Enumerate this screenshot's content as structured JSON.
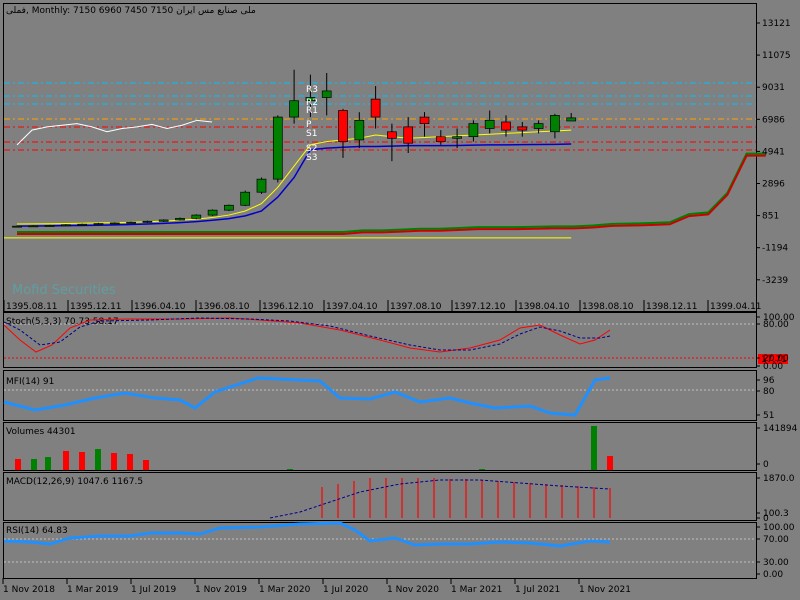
{
  "header": {
    "symbol": "فملی",
    "timeframe": "Monthly",
    "ohlc": "7150 6960 7450 7150",
    "company": "ملی صنایع مس ایران"
  },
  "watermark": "Mofid Securities",
  "colors": {
    "background": "#808080",
    "bull": "#008000",
    "bear": "#ff0000",
    "ma_fast": "#ffff00",
    "ma_slow": "#0000cc",
    "envelope_red": "#cc0000",
    "envelope_green": "#008000",
    "white_line": "#ffffff",
    "indicator_line": "#1e90ff",
    "level_cyan": "#00bfff",
    "level_red": "#ff0000",
    "level_orange": "#ffa500"
  },
  "main_axis": {
    "ticks": [
      "13121",
      "11075",
      "9031",
      "6986",
      "4941",
      "2896",
      "851",
      "-1194",
      "-3239"
    ]
  },
  "date_axis_top": [
    "1395.08.11",
    "1395.12.11",
    "1396.04.10",
    "1396.08.10",
    "1396.12.10",
    "1397.04.10",
    "1397.08.10",
    "1397.12.10",
    "1398.04.10",
    "1398.08.10",
    "1398.12.11",
    "1399.04.11"
  ],
  "date_axis_bottom": [
    "1 Nov 2018",
    "1 Mar 2019",
    "1 Jul 2019",
    "1 Nov 2019",
    "1 Mar 2020",
    "1 Jul 2020",
    "1 Nov 2020",
    "1 Mar 2021",
    "1 Jul 2021",
    "1 Nov 2021"
  ],
  "pivot_labels": [
    "R3",
    "R2",
    "R1",
    "P",
    "S1",
    "S2",
    "S3"
  ],
  "stoch": {
    "label": "Stoch(5,3,3) 70.73 58.17",
    "ticks": [
      "100.00",
      "80.00",
      "20.00",
      "0.00"
    ],
    "badge": "17.71"
  },
  "mfi": {
    "label": "MFI(14) 91",
    "ticks": [
      "96",
      "80",
      "51"
    ]
  },
  "volumes": {
    "label": "Volumes 44301",
    "ticks": [
      "141894",
      "0"
    ]
  },
  "macd": {
    "label": "MACD(12,26,9) 1047.6 1167.5",
    "ticks": [
      "1870.0",
      "100.3",
      "0"
    ]
  },
  "rsi": {
    "label": "RSI(14) 64.83",
    "ticks": [
      "100.00",
      "70.00",
      "30.00",
      "0.00"
    ]
  },
  "chart_data": {
    "type": "candlestick",
    "title": "فملی, Monthly",
    "candles": [
      {
        "o": 500,
        "h": 560,
        "l": 450,
        "c": 520
      },
      {
        "o": 520,
        "h": 580,
        "l": 480,
        "c": 540
      },
      {
        "o": 540,
        "h": 600,
        "l": 500,
        "c": 560
      },
      {
        "o": 560,
        "h": 640,
        "l": 520,
        "c": 600
      },
      {
        "o": 600,
        "h": 680,
        "l": 560,
        "c": 640
      },
      {
        "o": 640,
        "h": 720,
        "l": 600,
        "c": 680
      },
      {
        "o": 680,
        "h": 760,
        "l": 640,
        "c": 720
      },
      {
        "o": 720,
        "h": 800,
        "l": 680,
        "c": 760
      },
      {
        "o": 760,
        "h": 860,
        "l": 720,
        "c": 820
      },
      {
        "o": 820,
        "h": 940,
        "l": 780,
        "c": 900
      },
      {
        "o": 900,
        "h": 1050,
        "l": 860,
        "c": 1000
      },
      {
        "o": 1000,
        "h": 1250,
        "l": 950,
        "c": 1200
      },
      {
        "o": 1200,
        "h": 1550,
        "l": 1150,
        "c": 1500
      },
      {
        "o": 1500,
        "h": 1850,
        "l": 1450,
        "c": 1800
      },
      {
        "o": 1800,
        "h": 2700,
        "l": 1750,
        "c": 2600
      },
      {
        "o": 2600,
        "h": 3500,
        "l": 2500,
        "c": 3400
      },
      {
        "o": 3400,
        "h": 7300,
        "l": 3200,
        "c": 7200
      },
      {
        "o": 7200,
        "h": 10100,
        "l": 6800,
        "c": 8200
      },
      {
        "o": 8200,
        "h": 9800,
        "l": 7200,
        "c": 8400
      },
      {
        "o": 8400,
        "h": 9900,
        "l": 7300,
        "c": 8800
      },
      {
        "o": 7600,
        "h": 7700,
        "l": 4700,
        "c": 5700
      },
      {
        "o": 5800,
        "h": 7500,
        "l": 5300,
        "c": 7000
      },
      {
        "o": 8300,
        "h": 9100,
        "l": 6500,
        "c": 7200
      },
      {
        "o": 6300,
        "h": 6800,
        "l": 4500,
        "c": 5900
      },
      {
        "o": 6600,
        "h": 7200,
        "l": 5000,
        "c": 5600
      },
      {
        "o": 7200,
        "h": 7500,
        "l": 6000,
        "c": 6800
      },
      {
        "o": 6000,
        "h": 6400,
        "l": 5500,
        "c": 5700
      },
      {
        "o": 5900,
        "h": 6500,
        "l": 5300,
        "c": 6000
      },
      {
        "o": 6000,
        "h": 7000,
        "l": 5700,
        "c": 6800
      },
      {
        "o": 6500,
        "h": 7600,
        "l": 6200,
        "c": 7000
      },
      {
        "o": 6900,
        "h": 7300,
        "l": 6000,
        "c": 6400
      },
      {
        "o": 6600,
        "h": 6900,
        "l": 6000,
        "c": 6400
      },
      {
        "o": 6500,
        "h": 7000,
        "l": 6200,
        "c": 6800
      },
      {
        "o": 6300,
        "h": 7400,
        "l": 5900,
        "c": 7300
      },
      {
        "o": 6960,
        "h": 7450,
        "l": 6960,
        "c": 7150
      }
    ],
    "ma_fast": [
      650,
      660,
      670,
      680,
      700,
      720,
      740,
      760,
      790,
      830,
      880,
      950,
      1050,
      1200,
      1450,
      1900,
      2900,
      4200,
      5500,
      5700,
      5800,
      5900,
      6100,
      6000,
      5900,
      5950,
      6000,
      6050,
      6100,
      6150,
      6200,
      6250,
      6300,
      6350,
      6400
    ],
    "ma_slow": [
      520,
      530,
      540,
      550,
      560,
      580,
      600,
      620,
      650,
      690,
      740,
      800,
      880,
      980,
      1150,
      1450,
      2300,
      3500,
      5200,
      5300,
      5350,
      5400,
      5400,
      5420,
      5450,
      5450,
      5450,
      5460,
      5480,
      5500,
      5500,
      5510,
      5520,
      5530,
      5550
    ],
    "white_line": [
      5500,
      6400,
      6600,
      6700,
      6800,
      6600,
      6300,
      6500,
      6600,
      6750,
      6500,
      6700,
      7000,
      6900
    ],
    "envelope": [
      100,
      100,
      100,
      100,
      100,
      100,
      100,
      100,
      100,
      100,
      100,
      100,
      100,
      100,
      100,
      100,
      100,
      100,
      200,
      200,
      250,
      300,
      300,
      350,
      400,
      400,
      400,
      420,
      450,
      450,
      500,
      600,
      620,
      650,
      700,
      1200,
      1300,
      2500,
      4900,
      4900
    ],
    "ylim": [
      -4000,
      14000
    ]
  }
}
